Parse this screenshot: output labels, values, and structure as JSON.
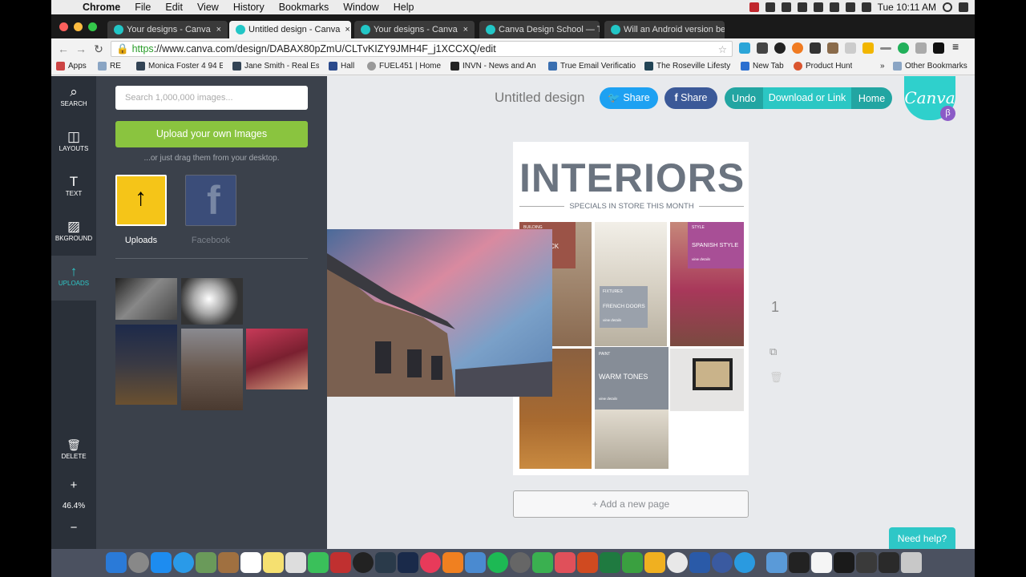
{
  "menubar": {
    "apple": "",
    "items": [
      "Chrome",
      "File",
      "Edit",
      "View",
      "History",
      "Bookmarks",
      "Window",
      "Help"
    ],
    "clock": "Tue 10:11 AM"
  },
  "tabs": [
    {
      "title": "Your designs - Canva"
    },
    {
      "title": "Untitled design - Canva"
    },
    {
      "title": "Your designs - Canva"
    },
    {
      "title": "Canva Design School — T"
    },
    {
      "title": "Will an Android version be"
    }
  ],
  "tab_close": "×",
  "address": {
    "https": "https",
    "rest": "://www.canva.com/design/DABAX80pZmU/CLTvKIZY9JMH4F_j1XCCXQ/edit",
    "star": "☆"
  },
  "bookmarks": [
    "Apps",
    "RE",
    "Monica Foster 4 94 E",
    "Jane Smith - Real Es",
    "Hall",
    "FUEL451 | Home",
    "INVN - News and An",
    "True Email Verificatio",
    "The Roseville Lifesty",
    "New Tab",
    "Product Hunt",
    "»",
    "Other Bookmarks"
  ],
  "rail": [
    {
      "label": "SEARCH",
      "icon": "⌕"
    },
    {
      "label": "LAYOUTS",
      "icon": "◫"
    },
    {
      "label": "TEXT",
      "icon": "T"
    },
    {
      "label": "BKGROUND",
      "icon": "▨"
    },
    {
      "label": "UPLOADS",
      "icon": "↑"
    }
  ],
  "rail_bottom": {
    "delete_label": "DELETE",
    "delete_icon": "🗑",
    "plus": "+",
    "zoom": "46.4%",
    "minus": "−"
  },
  "panel": {
    "search_placeholder": "Search 1,000,000 images...",
    "upload_label": "Upload your own Images",
    "drag_hint": "...or just drag them from your desktop.",
    "sources": [
      {
        "label": "Uploads"
      },
      {
        "label": "Facebook"
      }
    ]
  },
  "header": {
    "design_title": "Untitled design",
    "twitter_share": "Share",
    "facebook_share": "Share",
    "undo": "Undo",
    "download": "Download or Link",
    "home": "Home",
    "logo": "Canva",
    "beta": "β"
  },
  "page": {
    "heading": "INTERIORS",
    "subheading": "SPECIALS IN STORE THIS MONTH",
    "labels": {
      "spanish_tag": "STYLE",
      "spanish": "SPANISH STYLE",
      "french_tag": "FIXTURES",
      "french": "FRENCH DOORS",
      "warm_tag": "PAINT",
      "warm": "WARM TONES",
      "build_tag": "BUILDING",
      "build": "CK",
      "details": "view details"
    },
    "page_number": "1"
  },
  "add_page": "+ Add a new page",
  "help": "Need help?",
  "colors": {
    "accent": "#2ec7c7",
    "upload_green": "#8ac43f",
    "rail": "#2a3039",
    "panel": "#3b414b"
  }
}
